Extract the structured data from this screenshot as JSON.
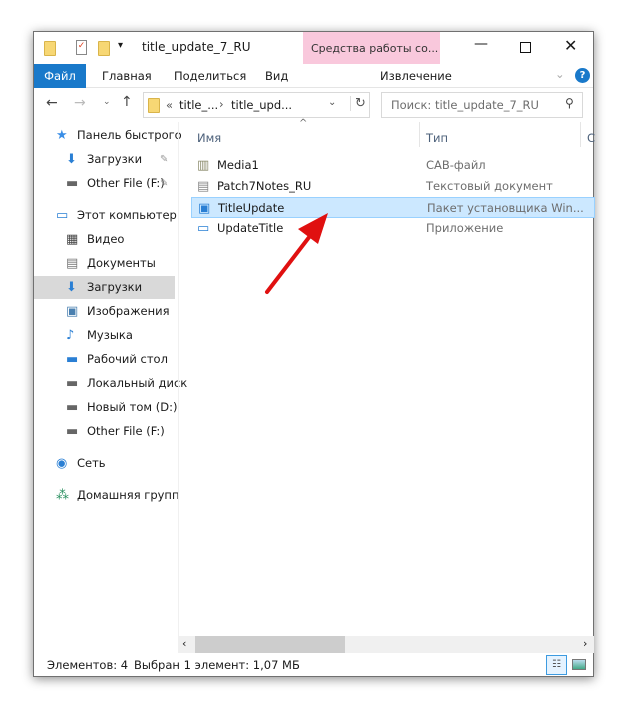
{
  "title": "title_update_7_RU",
  "context_tab": "Средства работы со...",
  "ribbon": {
    "file": "Файл",
    "tabs": [
      "Главная",
      "Поделиться",
      "Вид"
    ],
    "context": "Извлечение"
  },
  "address": {
    "segments": [
      "title_...",
      "title_upd..."
    ]
  },
  "search": {
    "placeholder": "Поиск: title_update_7_RU"
  },
  "sidebar": [
    {
      "label": "Панель быстрого",
      "icon": "star-icon"
    },
    {
      "label": "Загрузки",
      "icon": "download-icon",
      "pinned": true
    },
    {
      "label": "Other File (F:)",
      "icon": "drive-icon",
      "pinned": true
    },
    {
      "label": "Этот компьютер",
      "icon": "computer-icon"
    },
    {
      "label": "Видео",
      "icon": "video-icon"
    },
    {
      "label": "Документы",
      "icon": "documents-icon"
    },
    {
      "label": "Загрузки",
      "icon": "download-icon",
      "selected": true
    },
    {
      "label": "Изображения",
      "icon": "pictures-icon"
    },
    {
      "label": "Музыка",
      "icon": "music-icon"
    },
    {
      "label": "Рабочий стол",
      "icon": "desktop-icon"
    },
    {
      "label": "Локальный диск",
      "icon": "drive-icon"
    },
    {
      "label": "Новый том (D:)",
      "icon": "drive-icon"
    },
    {
      "label": "Other File (F:)",
      "icon": "drive-icon"
    },
    {
      "label": "Сеть",
      "icon": "network-icon"
    },
    {
      "label": "Домашняя групп",
      "icon": "homegroup-icon"
    }
  ],
  "columns": [
    "Имя",
    "Тип",
    "С"
  ],
  "files": [
    {
      "name": "Media1",
      "type": "CAB-файл",
      "icon": "cab-icon"
    },
    {
      "name": "Patch7Notes_RU",
      "type": "Текстовый документ",
      "icon": "text-file-icon"
    },
    {
      "name": "TitleUpdate",
      "type": "Пакет установщика Win...",
      "icon": "installer-icon",
      "selected": true
    },
    {
      "name": "UpdateTitle",
      "type": "Приложение",
      "icon": "app-icon"
    }
  ],
  "status": {
    "count": "Элементов: 4",
    "selection": "Выбран 1 элемент: 1,07 МБ"
  },
  "colors": {
    "accent": "#1979ca",
    "context": "#f9c8dc",
    "selection": "#cce8ff",
    "arrow": "#e01010"
  }
}
